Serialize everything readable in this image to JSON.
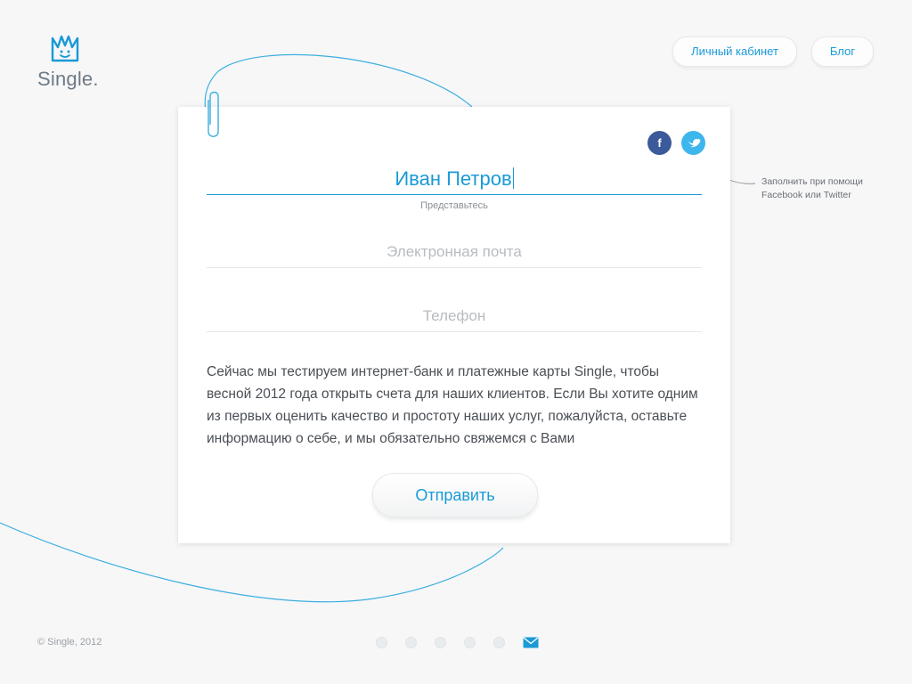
{
  "brand": {
    "name": "Single."
  },
  "nav": {
    "cabinet": "Личный кабинет",
    "blog": "Блог"
  },
  "form": {
    "social": {
      "facebook": "f"
    },
    "name_value": "Иван Петров",
    "name_hint": "Представьтесь",
    "email_placeholder": "Электронная почта",
    "phone_placeholder": "Телефон",
    "description": "Сейчас мы тестируем интернет-банк и платежные карты Single, чтобы весной 2012 года открыть счета для наших клиентов. Если Вы хотите одним из первых оценить качество и простоту наших услуг, пожалуйста, оставьте информацию о себе, и мы обязательно свяжемся с Вами",
    "submit_label": "Отправить"
  },
  "social_hint": {
    "line1": "Заполнить при помощи",
    "line2": "Facebook или Twitter"
  },
  "footer": {
    "copyright": "© Single, 2012"
  },
  "colors": {
    "accent": "#1a9ad6",
    "facebook": "#3b5a9a",
    "twitter": "#3db6ec",
    "background": "#f7f7f8"
  }
}
